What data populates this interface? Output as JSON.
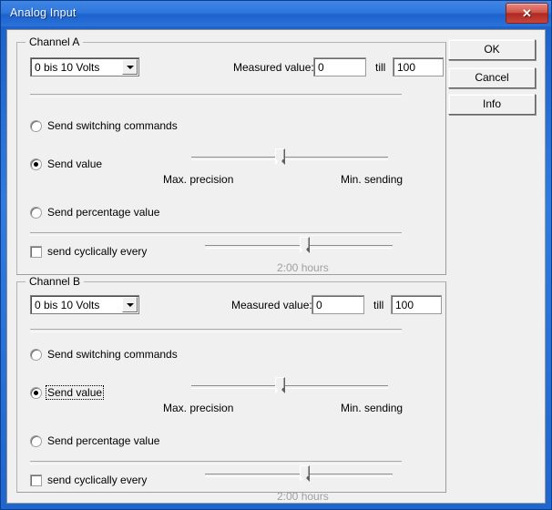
{
  "window": {
    "title": "Analog Input",
    "close_label": "✕",
    "close_icon": "close-icon"
  },
  "buttons": {
    "ok": "OK",
    "cancel": "Cancel",
    "info": "Info"
  },
  "labels": {
    "measured_value": "Measured value:",
    "till": "till",
    "max_precision": "Max. precision",
    "min_sending": "Min. sending",
    "cyclic_time": "2:00 hours"
  },
  "channels": [
    {
      "legend": "Channel A",
      "range_select": {
        "value": "0 bis 10 Volts",
        "arrow_icon": "chevron-down-icon"
      },
      "measured_from": "0",
      "measured_to": "100",
      "modes": [
        {
          "label": "Send switching commands",
          "checked": false,
          "focused": false
        },
        {
          "label": "Send value",
          "checked": true,
          "focused": false
        },
        {
          "label": "Send percentage value",
          "checked": false,
          "focused": false
        }
      ],
      "precision_slider": {
        "percent": 45
      },
      "cyclic": {
        "label": "send cyclically every",
        "checked": false,
        "slider": {
          "percent": 50
        },
        "value_text": "2:00 hours",
        "value_disabled": true
      }
    },
    {
      "legend": "Channel B",
      "range_select": {
        "value": "0 bis 10 Volts",
        "arrow_icon": "chevron-down-icon"
      },
      "measured_from": "0",
      "measured_to": "100",
      "modes": [
        {
          "label": "Send switching commands",
          "checked": false,
          "focused": false
        },
        {
          "label": "Send value",
          "checked": true,
          "focused": true
        },
        {
          "label": "Send percentage value",
          "checked": false,
          "focused": false
        }
      ],
      "precision_slider": {
        "percent": 45
      },
      "cyclic": {
        "label": "send cyclically every",
        "checked": false,
        "slider": {
          "percent": 50
        },
        "value_text": "2:00 hours",
        "value_disabled": true
      }
    }
  ],
  "colors": {
    "titlebar": "#2f77dd",
    "close": "#c9453c",
    "face": "#f0f0f0",
    "disabled_text": "#a0a0a0"
  }
}
